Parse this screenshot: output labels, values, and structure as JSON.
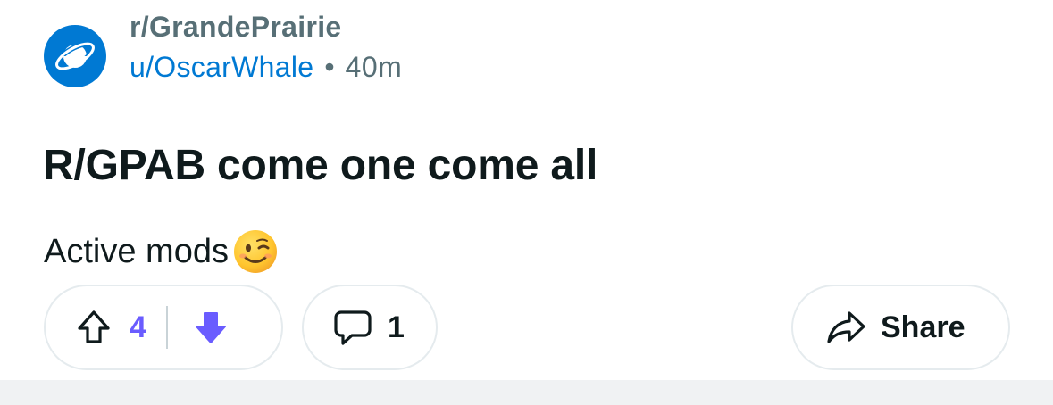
{
  "post": {
    "subreddit": "r/GrandePrairie",
    "author": "u/OscarWhale",
    "separator": "•",
    "time_ago": "40m",
    "title": "R/GPAB come one come all",
    "body_text": "Active mods",
    "body_emoji": "winking-face-emoji"
  },
  "actions": {
    "vote_count": "4",
    "comment_count": "1",
    "share_label": "Share",
    "upvote_icon": "arrow-up-outline-icon",
    "downvote_icon": "arrow-down-filled-icon",
    "comment_icon": "speech-bubble-icon",
    "share_icon": "share-arrow-icon"
  },
  "colors": {
    "brand_blue": "#0079d3",
    "vote_purple": "#6a5cff",
    "muted_text": "#576f76",
    "pill_border": "#e5ebee"
  }
}
